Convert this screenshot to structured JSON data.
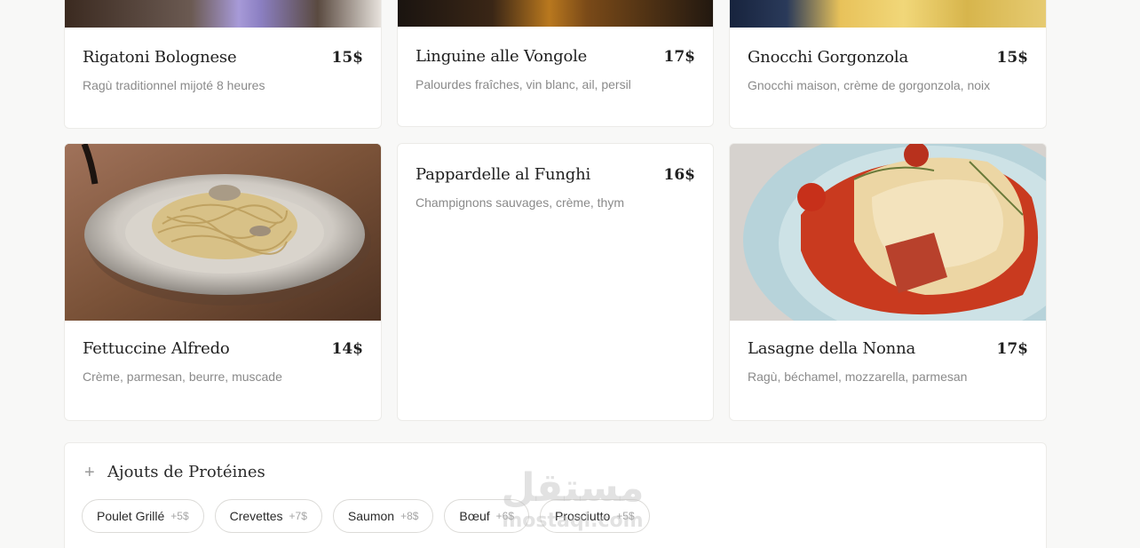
{
  "menu": {
    "dishes": [
      {
        "name": "Rigatoni Bolognese",
        "price": "15$",
        "description": "Ragù traditionnel mijoté 8 heures"
      },
      {
        "name": "Linguine alle Vongole",
        "price": "17$",
        "description": "Palourdes fraîches, vin blanc, ail, persil"
      },
      {
        "name": "Gnocchi Gorgonzola",
        "price": "15$",
        "description": "Gnocchi maison, crème de gorgonzola, noix"
      },
      {
        "name": "Fettuccine Alfredo",
        "price": "14$",
        "description": "Crème, parmesan, beurre, muscade"
      },
      {
        "name": "Pappardelle al Funghi",
        "price": "16$",
        "description": "Champignons sauvages, crème, thym"
      },
      {
        "name": "Lasagne della Nonna",
        "price": "17$",
        "description": "Ragù, béchamel, mozzarella, parmesan"
      }
    ]
  },
  "addons": {
    "icon": "plus-icon",
    "title": "Ajouts de Protéines",
    "items": [
      {
        "label": "Poulet Grillé",
        "price": "+5$"
      },
      {
        "label": "Crevettes",
        "price": "+7$"
      },
      {
        "label": "Saumon",
        "price": "+8$"
      },
      {
        "label": "Bœuf",
        "price": "+6$"
      },
      {
        "label": "Prosciutto",
        "price": "+5$"
      }
    ]
  },
  "watermark": {
    "arabic": "مستقل",
    "latin": "mostaql.com"
  }
}
